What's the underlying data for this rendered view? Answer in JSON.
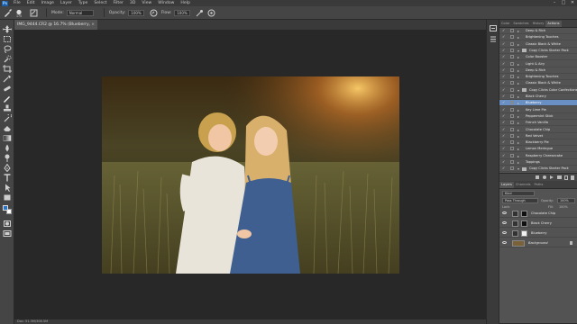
{
  "app": {
    "logo": "Ps",
    "menu": [
      "File",
      "Edit",
      "Image",
      "Layer",
      "Type",
      "Select",
      "Filter",
      "3D",
      "View",
      "Window",
      "Help"
    ],
    "window_controls": [
      "–",
      "□",
      "✕"
    ]
  },
  "options_bar": {
    "brush_size": "175",
    "mode_label": "Mode:",
    "mode_value": "Normal",
    "opacity_label": "Opacity:",
    "opacity_value": "100%",
    "flow_label": "Flow:",
    "flow_value": "100%"
  },
  "document": {
    "tab_title": "IMG_9444.CR2 @ 16.7% (Blueberry, RGB/8) *",
    "close": "×",
    "status": "Doc: 51.3M/308.5M"
  },
  "actions_panel": {
    "tabs": [
      "Color",
      "Swatches",
      "History",
      "Actions"
    ],
    "active_tab": "Actions",
    "rows": [
      {
        "label": "Deep & Rich",
        "type": "sub"
      },
      {
        "label": "Brightening Touches",
        "type": "sub"
      },
      {
        "label": "Classic Black & White",
        "type": "sub"
      },
      {
        "label": "Copy Clicks Starter Pack",
        "type": "folder"
      },
      {
        "label": "Color Booster",
        "type": "sub"
      },
      {
        "label": "Light & Airy",
        "type": "sub"
      },
      {
        "label": "Deep & Rich",
        "type": "sub"
      },
      {
        "label": "Brightening Touches",
        "type": "sub"
      },
      {
        "label": "Classic Black & White",
        "type": "sub"
      },
      {
        "label": "Copy Clicks Color Confections",
        "type": "folder"
      },
      {
        "label": "Black Cherry",
        "type": "sub"
      },
      {
        "label": "Blueberry",
        "type": "selected"
      },
      {
        "label": "Key Lime Pie",
        "type": "sub"
      },
      {
        "label": "Peppermint Stick",
        "type": "sub"
      },
      {
        "label": "French Vanilla",
        "type": "sub"
      },
      {
        "label": "Chocolate Chip",
        "type": "sub"
      },
      {
        "label": "Red Velvet",
        "type": "sub"
      },
      {
        "label": "Blackberry Pie",
        "type": "sub"
      },
      {
        "label": "Lemon Meringue",
        "type": "sub"
      },
      {
        "label": "Raspberry Cheesecake",
        "type": "sub"
      },
      {
        "label": "Toppings",
        "type": "sub"
      },
      {
        "label": "Copy Clicks Starter Pack",
        "type": "folder"
      }
    ]
  },
  "layers_panel": {
    "tabs": [
      "Layers",
      "Channels",
      "Paths"
    ],
    "active_tab": "Layers",
    "kind_label": "Kind",
    "blend_mode": "Pass Through",
    "opacity_label": "Opacity:",
    "opacity_value": "100%",
    "lock_label": "Lock:",
    "fill_label": "Fill:",
    "fill_value": "100%",
    "layers": [
      {
        "name": "Chocolate Chip",
        "mask": "black"
      },
      {
        "name": "Black Cherry",
        "mask": "black"
      },
      {
        "name": "Blueberry",
        "mask": "white"
      },
      {
        "name": "Background",
        "mask": "none"
      }
    ]
  },
  "colors": {
    "foreground": "#2a72c4",
    "background": "#ffffff",
    "selection": "#6a8fc2"
  }
}
